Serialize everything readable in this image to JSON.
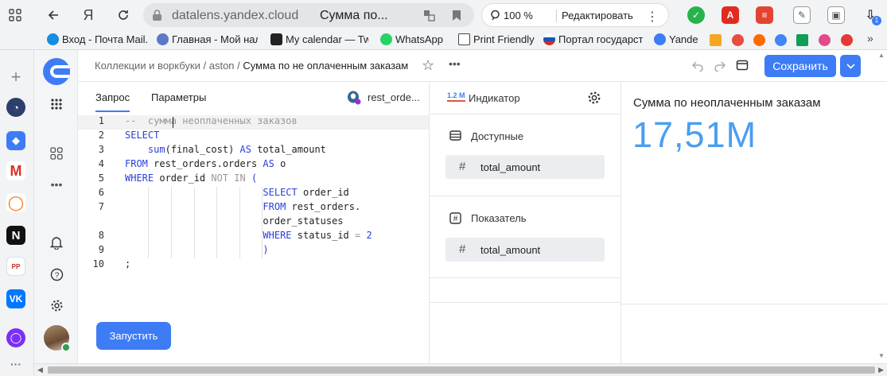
{
  "browser": {
    "domain": "datalens.yandex.cloud",
    "tab_title": "Сумма по...",
    "zoom": "100 %",
    "edit_label": "Редактировать",
    "ext_badge": "1",
    "bookmarks": [
      {
        "label": "Вход - Почта Mail.",
        "color": "#168de2"
      },
      {
        "label": "Главная - Мой нал",
        "color": "#5a79c8"
      },
      {
        "label": "My calendar — Tw",
        "color": "#222222"
      },
      {
        "label": "WhatsApp",
        "color": "#25d366"
      },
      {
        "label": "Print Friendly",
        "color": "#444444"
      },
      {
        "label": "Портал государст",
        "color": "#d52b1e"
      },
      {
        "label": "Yande",
        "color": "#3d7cf5"
      }
    ]
  },
  "app": {
    "breadcrumb": {
      "collections": "Коллекции и воркбуки",
      "folder": "aston",
      "current": "Сумма по не оплаченным заказам"
    },
    "save_label": "Сохранить",
    "run_label": "Запустить"
  },
  "query": {
    "tabs": [
      "Запрос",
      "Параметры"
    ],
    "connection": "rest_orde..."
  },
  "wizard": {
    "indicator_badge": "1.2 M",
    "indicator_label": "Индикатор",
    "available_label": "Доступные",
    "available_field": "total_amount",
    "measure_label": "Показатель",
    "measure_field": "total_amount"
  },
  "preview": {
    "title": "Сумма по неоплаченным заказам",
    "value": "17,51M",
    "accent": "#4a9ef0"
  },
  "code": [
    {
      "n": "1",
      "parts": [
        [
          "cm",
          "--  сумма неоплаченных заказов"
        ]
      ],
      "current": true
    },
    {
      "n": "2",
      "parts": [
        [
          "kw",
          "SELECT"
        ]
      ]
    },
    {
      "n": "3",
      "parts": [
        [
          "",
          "    "
        ],
        [
          "kw",
          "sum"
        ],
        [
          "",
          "(final_cost) "
        ],
        [
          "kw",
          "AS"
        ],
        [
          "",
          " total_amount"
        ]
      ]
    },
    {
      "n": "4",
      "parts": [
        [
          "kw",
          "FROM"
        ],
        [
          "",
          " rest_orders.orders "
        ],
        [
          "kw",
          "AS"
        ],
        [
          "",
          " o"
        ]
      ]
    },
    {
      "n": "5",
      "parts": [
        [
          "kw",
          "WHERE"
        ],
        [
          "",
          " order_id "
        ],
        [
          "cm",
          "NOT IN"
        ],
        [
          "kw",
          " ("
        ]
      ]
    },
    {
      "n": "6",
      "parts": [
        [
          "",
          "                        "
        ],
        [
          "kw",
          "SELECT"
        ],
        [
          "",
          " order_id"
        ]
      ]
    },
    {
      "n": "7",
      "parts": [
        [
          "",
          "                        "
        ],
        [
          "kw",
          "FROM"
        ],
        [
          "",
          " rest_orders."
        ]
      ]
    },
    {
      "n": "",
      "parts": [
        [
          "",
          "                        order_statuses"
        ]
      ]
    },
    {
      "n": "8",
      "parts": [
        [
          "",
          "                        "
        ],
        [
          "kw",
          "WHERE"
        ],
        [
          "",
          " status_id "
        ],
        [
          "cm",
          "="
        ],
        [
          "num",
          " 2"
        ]
      ]
    },
    {
      "n": "9",
      "parts": [
        [
          "",
          "                        "
        ],
        [
          "kw",
          ")"
        ]
      ]
    },
    {
      "n": "10",
      "parts": [
        [
          "",
          ";"
        ]
      ]
    }
  ]
}
